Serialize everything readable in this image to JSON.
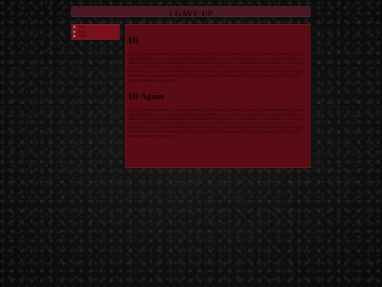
{
  "header": {
    "title": "I GAVE UP"
  },
  "nav": {
    "items": [
      {
        "label": "link"
      },
      {
        "label": "link"
      },
      {
        "label": "link"
      }
    ]
  },
  "main": {
    "sections": [
      {
        "heading": "Hi",
        "body": "Lorem ipsum dolor sit amet, consectetur adipiscing elit. In nec nisi metus. Donec ornare volutpat bibendum. Fusce eget malesuada lacus. Integer ornare sapien ut risus finibus mollis. Proin sit amet nisl a nunc interdum consectetur. Duis congue eget enim in scelerisque. Phasellus diam felis, rhoncus sed scelerisque id amet, sodales et orci. Donec sed laoreet tellus. Fusce vitae dignissim lectus, ac volutpat tellus. Praesent dui orci, dictum non nisi id, ornare euismod ligula. Suspendisse id malesuada lacus ac ante ipsum primis in faucibus. Vestibulum sit amet iaculis ligula. Vestibulum ante ipsum primis in faucibus orci luctus et ultrices posuere cubilia curae; Aliquam et nisl id sem non ipsum euismod non eget ante."
      },
      {
        "heading": "Hi Again",
        "body": "Lorem ipsum dolor sit amet, consectetur adipiscing elit. In nec nisi metus. Donec ornare volutpat bibendum. Fusce eget malesuada lacus. Integer ornare sapien ut risus finibus mollis. Proin sit amet nisl a nunc interdum consectetur. Duis congue eget enim in scelerisque. Phasellus diam felis, rhoncus sed scelerisque id amet, sodales et orci. Donec sed laoreet tellus. Fusce vitae dignissim lectus, ac volutpat tellus. Praesent dui orci, dictum non nisi id, ornare euismod ligula. Suspendisse id malesuada lacus ac ante ipsum primis in faucibus. Vestibulum sit amet iaculis ligula. Vestibulum ante ipsum primis in faucibus orci luctus et ultrices posuere cubilia curae; Aliquam et nisl id sem non ipsum euismod non eget ante."
      }
    ]
  },
  "colors": {
    "page_background": "#0d0d0d",
    "header_background": "#4a1822",
    "nav_background": "#7a0f1e",
    "main_background": "#5a0b14",
    "text_dark": "#0c0204"
  }
}
